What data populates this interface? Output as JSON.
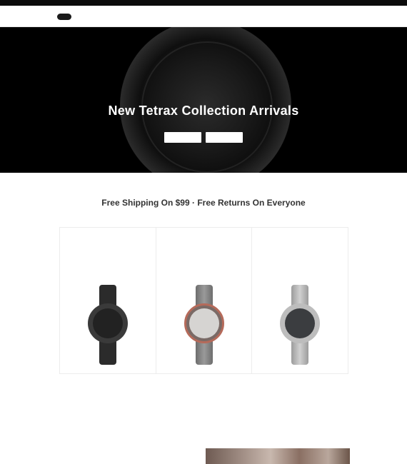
{
  "promo": {
    "text": ""
  },
  "header": {
    "brand": "",
    "nav": [
      "",
      "",
      "",
      "",
      ""
    ],
    "actions": [
      "",
      ""
    ]
  },
  "hero": {
    "title": "New Tetrax Collection Arrivals",
    "subtitle": "",
    "buttons": [
      "",
      ""
    ]
  },
  "section": {
    "kicker": "",
    "title": "Free Shipping On $99 · Free Returns On Everyone",
    "subtitle": ""
  },
  "products": [
    {
      "name": "",
      "description": "",
      "price": ""
    },
    {
      "name": "",
      "description": "",
      "price": ""
    },
    {
      "name": "",
      "description": "",
      "price": ""
    }
  ],
  "bottom": {
    "heading": "",
    "subheading": ""
  },
  "colors": {
    "hero_bg": "#000000",
    "promo_bg": "#0b0b0b",
    "text_dark": "#333333"
  }
}
